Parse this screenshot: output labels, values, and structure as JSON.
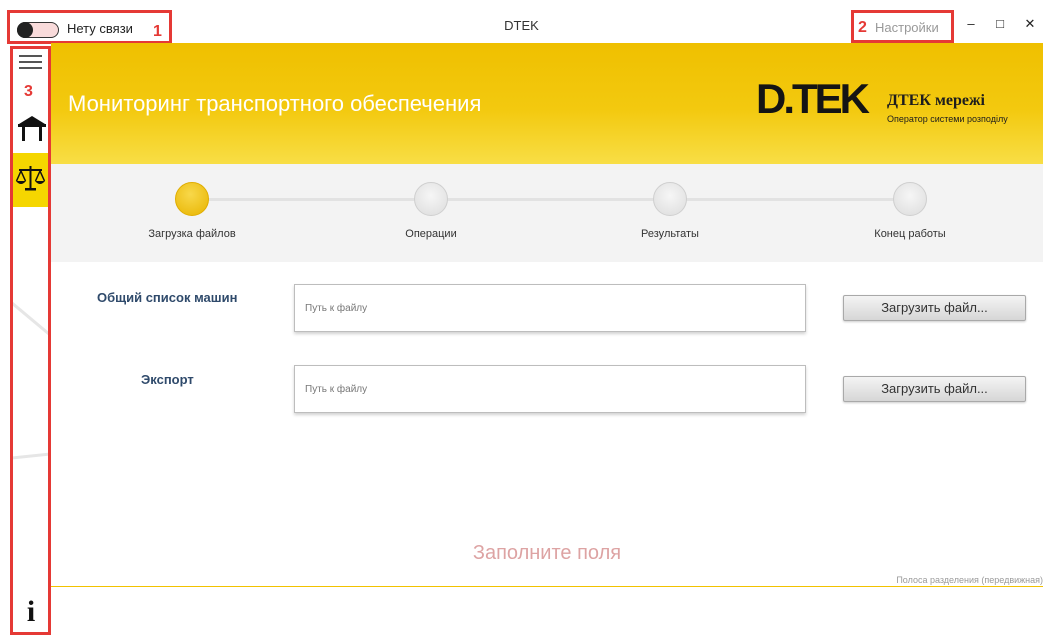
{
  "window": {
    "title": "DTEK",
    "connection_label": "Нету связи",
    "settings_label": "Настройки",
    "minimize_glyph": "–",
    "maximize_glyph": "□",
    "close_glyph": "✕"
  },
  "annotations": {
    "badge1": "1",
    "badge2": "2",
    "badge3": "3"
  },
  "sidebar": {
    "items": [
      {
        "icon": "menu-icon"
      },
      {
        "icon": "home-icon"
      },
      {
        "icon": "scales-icon",
        "active": true
      },
      {
        "icon": "info-icon",
        "glyph": "i"
      }
    ]
  },
  "header": {
    "title": "Мониторинг транспортного обеспечения",
    "logo_text": "D.TEK",
    "brand_name": "ДТЕК мережі",
    "brand_sub": "Оператор системи розподілу"
  },
  "steps": [
    {
      "label": "Загрузка файлов",
      "active": true
    },
    {
      "label": "Операции",
      "active": false
    },
    {
      "label": "Результаты",
      "active": false
    },
    {
      "label": "Конец работы",
      "active": false
    }
  ],
  "form": {
    "row1": {
      "label": "Общий список машин",
      "placeholder": "Путь к файлу",
      "value": "",
      "button": "Загрузить файл..."
    },
    "row2": {
      "label": "Экспорт",
      "placeholder": "Путь к файлу",
      "value": "",
      "button": "Загрузить файл..."
    }
  },
  "status": {
    "message": "Заполните поля",
    "splitter_hint": "Полоса разделения (передвижная)"
  },
  "colors": {
    "accent": "#f3c90f",
    "annotation": "#e53935",
    "label": "#2f4a6b",
    "message": "#dda3a3"
  }
}
